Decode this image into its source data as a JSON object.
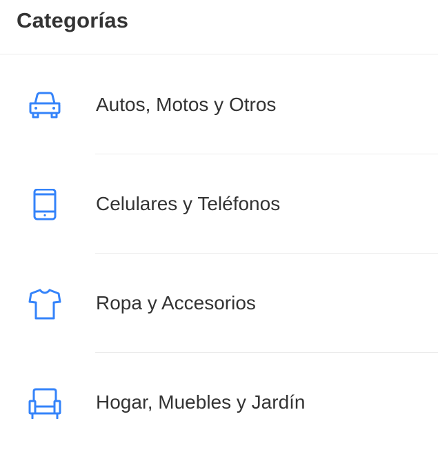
{
  "header": {
    "title": "Categorías"
  },
  "colors": {
    "icon": "#3483fa",
    "text": "#333333",
    "divider": "#ebebeb"
  },
  "categories": [
    {
      "label": "Autos, Motos y Otros",
      "icon": "car-icon"
    },
    {
      "label": "Celulares y Teléfonos",
      "icon": "phone-icon"
    },
    {
      "label": "Ropa y Accesorios",
      "icon": "shirt-icon"
    },
    {
      "label": "Hogar, Muebles y Jardín",
      "icon": "armchair-icon"
    }
  ]
}
